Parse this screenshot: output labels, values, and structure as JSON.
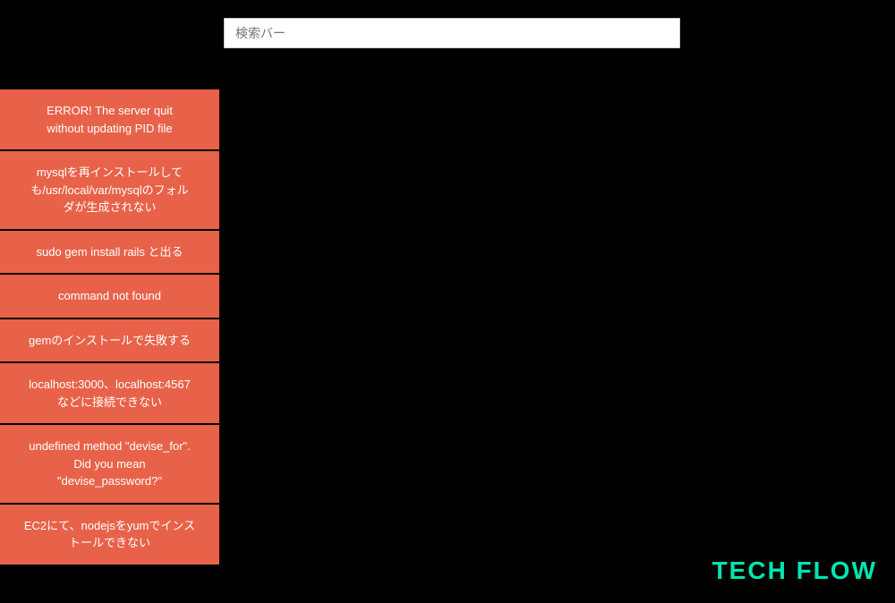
{
  "search": {
    "placeholder": "検索バー"
  },
  "sidebar": {
    "items": [
      {
        "label": "ERROR! The server quit\nwithout updating PID file"
      },
      {
        "label": "mysqlを再インストールして\nも/usr/local/var/mysqlのフォル\nダが生成されない"
      },
      {
        "label": "sudo gem install rails と出る"
      },
      {
        "label": "command not found"
      },
      {
        "label": "gemのインストールで失敗する"
      },
      {
        "label": "localhost:3000、localhost:4567\nなどに接続できない"
      },
      {
        "label": "undefined method \"devise_for\".\nDid you mean\n\"devise_password?\""
      },
      {
        "label": "EC2にて、nodejsをyumでインス\nトールできない"
      }
    ]
  },
  "brand": {
    "label": "TECH FLOW"
  }
}
